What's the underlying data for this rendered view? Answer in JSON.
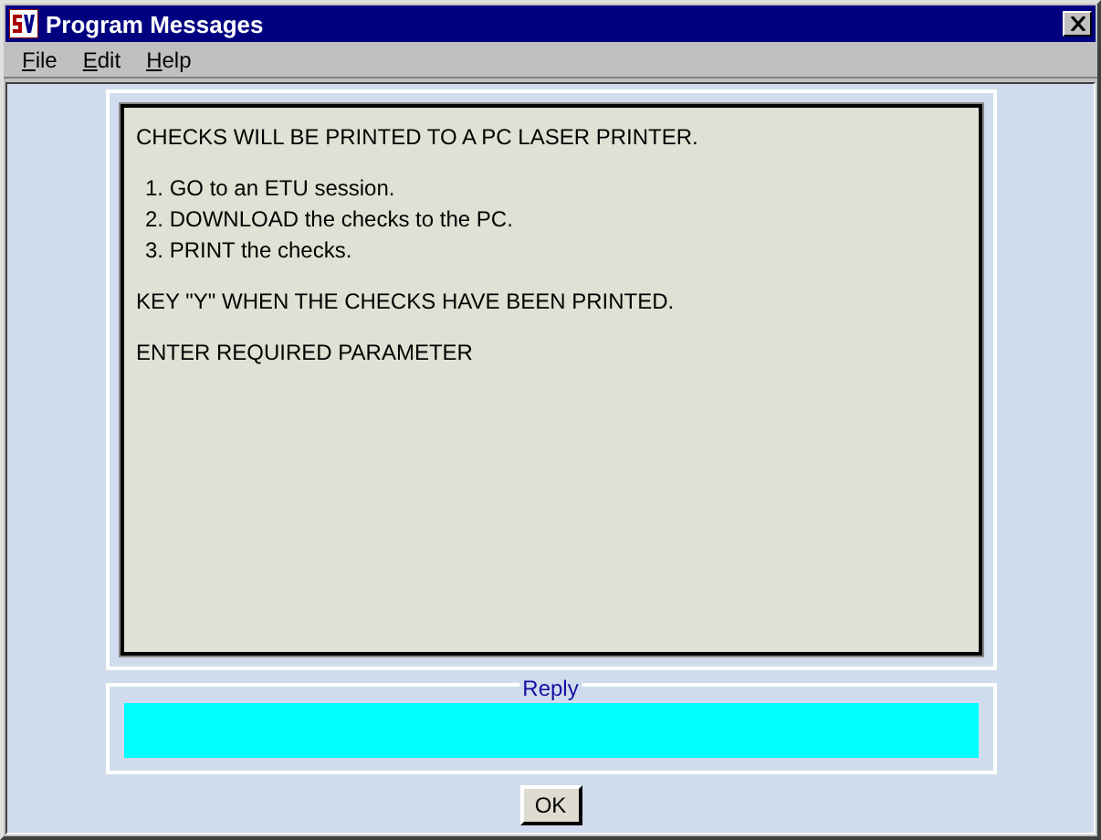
{
  "window": {
    "title": "Program Messages"
  },
  "menu": [
    "File",
    "Edit",
    "Help"
  ],
  "message": [
    {
      "kind": "text",
      "text": "CHECKS WILL BE PRINTED TO A PC LASER PRINTER."
    },
    {
      "kind": "list",
      "items": [
        "1. GO to an ETU session.",
        "2. DOWNLOAD the checks to the PC.",
        "3. PRINT the checks."
      ]
    },
    {
      "kind": "text",
      "text": "KEY \"Y\" WHEN THE CHECKS HAVE BEEN PRINTED."
    },
    {
      "kind": "text",
      "text": "ENTER REQUIRED PARAMETER"
    }
  ],
  "reply": {
    "label": "Reply"
  },
  "buttons": [
    "OK"
  ]
}
